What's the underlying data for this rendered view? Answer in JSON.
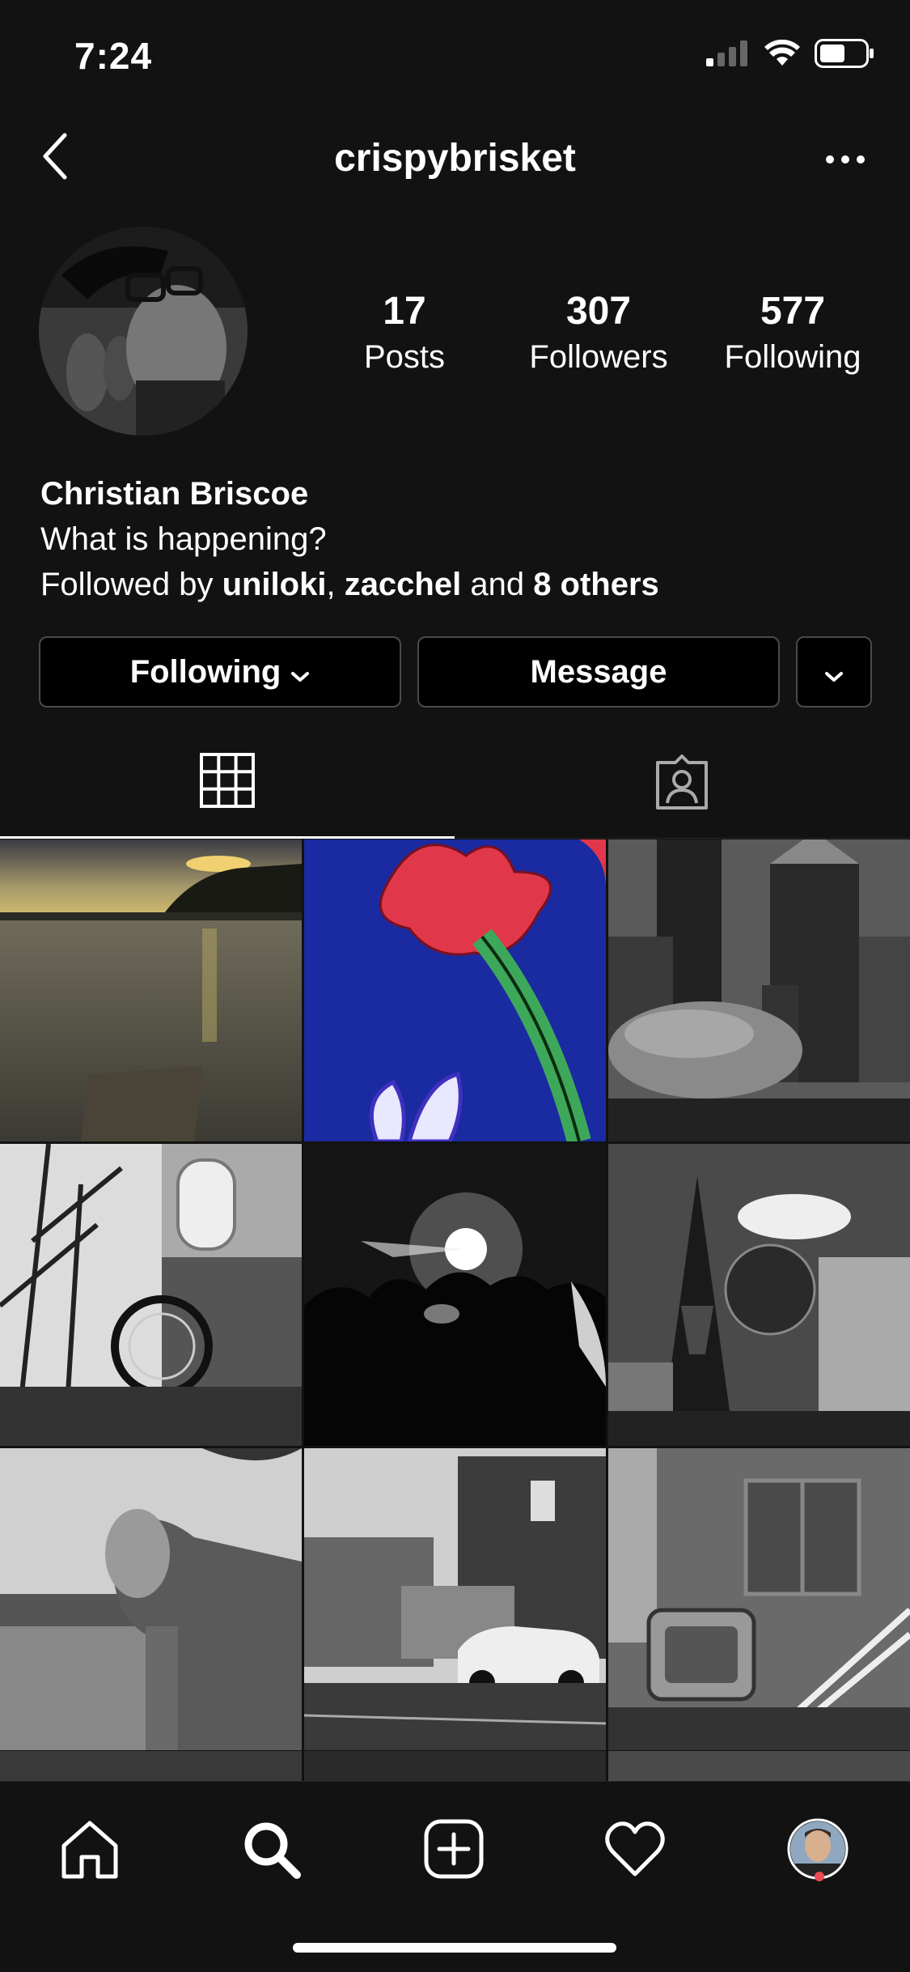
{
  "status_bar": {
    "time": "7:24",
    "icons": [
      "signal-icon",
      "wifi-icon",
      "battery-icon"
    ]
  },
  "header": {
    "username": "crispybrisket",
    "icons": [
      "back-chevron-icon",
      "more-dots-icon"
    ]
  },
  "profile": {
    "stats": [
      {
        "value": "17",
        "label": "Posts"
      },
      {
        "value": "307",
        "label": "Followers"
      },
      {
        "value": "577",
        "label": "Following"
      }
    ],
    "name": "Christian Briscoe",
    "bio": "What is happening?",
    "followed_by": {
      "prefix": "Followed by ",
      "user1": "uniloki",
      "separator": ", ",
      "user2": "zacchel",
      "conjunction": " and ",
      "others": "8 others"
    }
  },
  "actions": {
    "following_label": "Following",
    "message_label": "Message"
  },
  "tabs": [
    {
      "name": "grid-tab",
      "icon": "grid-icon",
      "active": true
    },
    {
      "name": "tagged-tab",
      "icon": "tagged-person-icon",
      "active": false
    }
  ],
  "grid_posts": [
    "lake-sunset",
    "red-flower-lantern",
    "chicago-bean-skyline",
    "bicycle-propane-tank",
    "concert-crowd-light",
    "las-vegas-eiffel",
    "wooden-troll-sculpture",
    "street-building-car",
    "discarded-tv"
  ],
  "bottom_nav": {
    "items": [
      "home-icon",
      "search-icon",
      "new-post-icon",
      "heart-icon",
      "profile-avatar"
    ],
    "active": "search-icon"
  },
  "colors": {
    "background": "#121212",
    "button_border": "#4a4a4a",
    "notification_dot": "#ed4956"
  }
}
